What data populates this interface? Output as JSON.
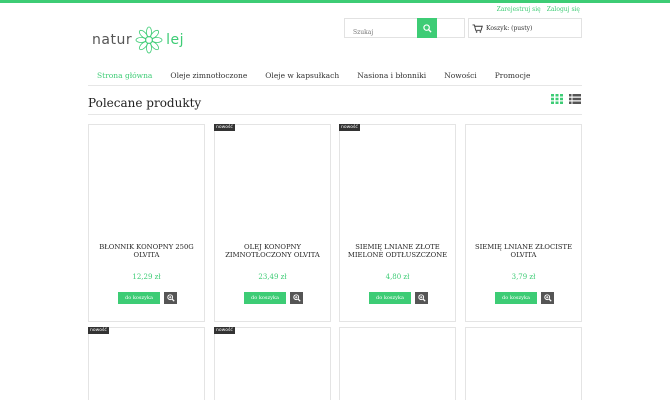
{
  "userlinks": {
    "register": "Zarejestruj się",
    "login": "Zaloguj się"
  },
  "logo": {
    "part1": "natur",
    "part2": "lej"
  },
  "search": {
    "placeholder": "Szukaj"
  },
  "cart": {
    "label": "Koszyk: (pusty)"
  },
  "nav": {
    "items": [
      {
        "label": "Strona główna"
      },
      {
        "label": "Oleje zimnotłoczone"
      },
      {
        "label": "Oleje w kapsułkach"
      },
      {
        "label": "Nasiona i błonniki"
      },
      {
        "label": "Nowości"
      },
      {
        "label": "Promocje"
      }
    ]
  },
  "section": {
    "title": "Polecane produkty"
  },
  "colors": {
    "accent": "#3dcc75",
    "dark": "#333333"
  },
  "products": [
    {
      "name": "BŁONNIK KONOPNY 250g OlVita",
      "price": "12,29 zł",
      "badge": "",
      "button": "do koszyka"
    },
    {
      "name": "OLEJ KONOPNY ZIMNOTŁOCZONY OlVita",
      "price": "23,49 zł",
      "badge": "nowość",
      "button": "do koszyka"
    },
    {
      "name": "SIEMIĘ LNIANE ZŁOTE MIELONE ODTŁUSZCZONE",
      "price": "4,80 zł",
      "badge": "nowość",
      "button": "do koszyka"
    },
    {
      "name": "SIEMIĘ LNIANE ZŁOCISTE OlVita",
      "price": "3,79 zł",
      "badge": "",
      "button": "do koszyka"
    },
    {
      "name": "",
      "price": "",
      "badge": "nowość",
      "button": ""
    },
    {
      "name": "",
      "price": "",
      "badge": "nowość",
      "button": ""
    },
    {
      "name": "",
      "price": "",
      "badge": "",
      "button": ""
    },
    {
      "name": "",
      "price": "",
      "badge": "",
      "button": ""
    }
  ]
}
